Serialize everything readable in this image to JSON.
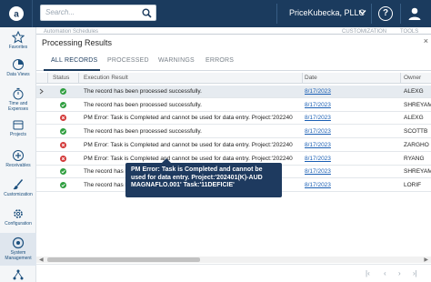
{
  "topbar": {
    "search_placeholder": "Search...",
    "company": "PriceKubecka, PLLC",
    "help_label": "?",
    "icons": [
      "acumatica-logo-icon",
      "search-icon",
      "chevron-down-icon",
      "help-icon",
      "user-icon"
    ]
  },
  "sidebar": {
    "items": [
      {
        "label": "Favorites",
        "icon": "star-icon"
      },
      {
        "label": "Data Views",
        "icon": "chart-icon"
      },
      {
        "label": "Time and Expenses",
        "icon": "stopwatch-icon"
      },
      {
        "label": "Projects",
        "icon": "projects-icon"
      },
      {
        "label": "Receivables",
        "icon": "plus-circle-icon"
      },
      {
        "label": "Customization",
        "icon": "brush-icon"
      },
      {
        "label": "Configuration",
        "icon": "gear-icon"
      },
      {
        "label": "System Management",
        "icon": "system-icon",
        "active": true
      }
    ]
  },
  "background_page": {
    "left_hint": "Automation Schedules",
    "customization": "CUSTOMIZATION",
    "tools": "TOOLS"
  },
  "dialog": {
    "title": "Processing Results",
    "close": "×",
    "tabs": [
      {
        "label": "ALL RECORDS",
        "active": true
      },
      {
        "label": "PROCESSED",
        "active": false
      },
      {
        "label": "WARNINGS",
        "active": false
      },
      {
        "label": "ERRORS",
        "active": false
      }
    ],
    "columns": {
      "status": "Status",
      "result": "Execution Result",
      "date": "Date",
      "owner": "Owner"
    },
    "rows": [
      {
        "status": "success",
        "result": "The record has been processed successfully.",
        "date": "8/17/2023",
        "owner": "ALEXG",
        "selected": true
      },
      {
        "status": "success",
        "result": "The record has been processed successfully.",
        "date": "8/17/2023",
        "owner": "SHREYAM"
      },
      {
        "status": "error",
        "result": "PM Error: Task is Completed and cannot be used for data entry. Project:'202240",
        "date": "8/17/2023",
        "owner": "ALEXG"
      },
      {
        "status": "success",
        "result": "The record has been processed successfully.",
        "date": "8/17/2023",
        "owner": "SCOTTB"
      },
      {
        "status": "error",
        "result": "PM Error: Task is Completed and cannot be used for data entry. Project:'202240",
        "date": "8/17/2023",
        "owner": "ZARGHO"
      },
      {
        "status": "error",
        "result": "PM Error: Task is Completed and cannot be used for data entry. Project:'202240",
        "date": "8/17/2023",
        "owner": "RYANG"
      },
      {
        "status": "success",
        "result": "The record has been processed successfully.",
        "date": "8/17/2023",
        "owner": "SHREYAM"
      },
      {
        "status": "success",
        "result": "The record has been processed successfully.",
        "date": "8/17/2023",
        "owner": "LORIF"
      }
    ],
    "tooltip": "PM Error: Task is Completed and cannot be used for data entry. Project:'202401(K)-AUD MAGNAFLO.001' Task:'11DEFICIE'"
  },
  "pager": {
    "first": "|‹",
    "prev": "‹",
    "next": "›",
    "last": "›|"
  },
  "colors": {
    "topbar": "#1b3b5e",
    "success": "#2e9e3e",
    "error": "#d33a3a",
    "link": "#1a5fb4",
    "tooltip": "#1e3a5f"
  }
}
